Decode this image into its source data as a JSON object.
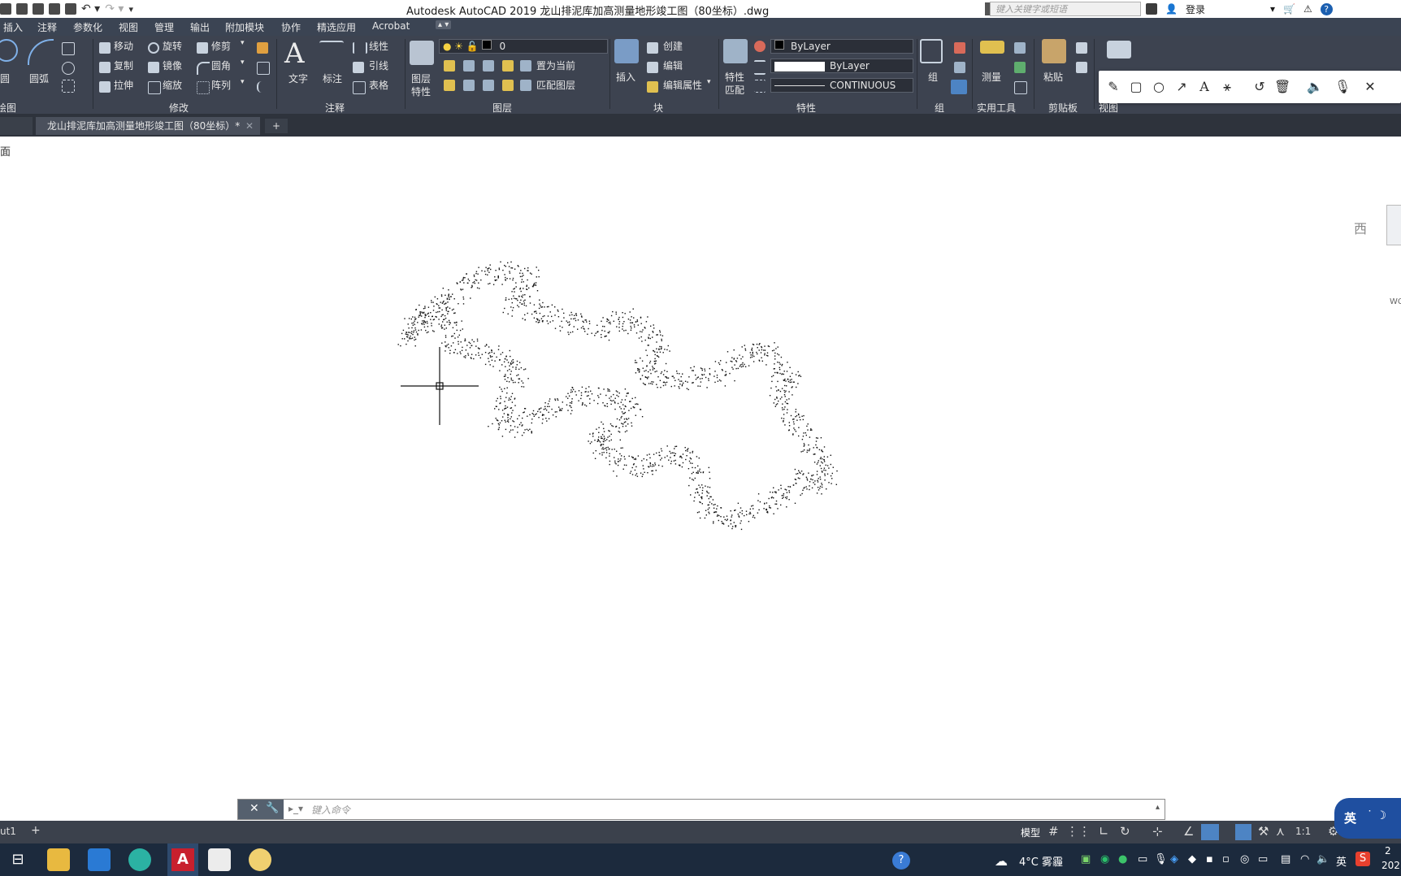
{
  "app": {
    "window_title": "Autodesk AutoCAD 2019    龙山排泥库加高测量地形竣工图（80坐标）.dwg",
    "search_placeholder": "键入关键字或短语",
    "login": "登录"
  },
  "menu_tabs": [
    "插入",
    "注释",
    "参数化",
    "视图",
    "管理",
    "输出",
    "附加模块",
    "协作",
    "精选应用",
    "Acrobat"
  ],
  "ribbon": {
    "draw": {
      "circle": "圆",
      "arc": "圆弧",
      "panel_title": "绘图"
    },
    "modify": {
      "move": "移动",
      "rotate": "旋转",
      "trim": "修剪",
      "copy": "复制",
      "mirror": "镜像",
      "fillet": "圆角",
      "stretch": "拉伸",
      "scale": "缩放",
      "array": "阵列",
      "panel_title": "修改"
    },
    "annotation": {
      "text": "文字",
      "dimension": "标注",
      "linear": "线性",
      "leader": "引线",
      "table": "表格",
      "panel_title": "注释"
    },
    "layers": {
      "layer_props_1": "图层",
      "layer_props_2": "特性",
      "current_layer": "0",
      "set_current": "置为当前",
      "match_layer": "匹配图层",
      "panel_title": "图层"
    },
    "block": {
      "insert": "插入",
      "create": "创建",
      "edit": "编辑",
      "edit_attr": "编辑属性",
      "panel_title": "块"
    },
    "properties": {
      "match_1": "特性",
      "match_2": "匹配",
      "color": "ByLayer",
      "lineweight": "ByLayer",
      "linetype": "CONTINUOUS",
      "panel_title": "特性"
    },
    "groups": {
      "group": "组",
      "panel_title": "组"
    },
    "utilities": {
      "measure": "测量",
      "panel_title": "实用工具"
    },
    "clipboard": {
      "paste": "粘贴",
      "panel_title": "剪贴板"
    },
    "view": {
      "panel_title": "视图"
    }
  },
  "doc_tab": {
    "label": "龙山排泥库加高测量地形竣工图（80坐标）*"
  },
  "canvas": {
    "corner_label": "面",
    "viewcube_label": "西",
    "viewcube_wcs": "WC"
  },
  "command": {
    "placeholder": "键入命令"
  },
  "status": {
    "layout_tab": "ut1",
    "model": "模型",
    "scale": "1:1"
  },
  "taskbar": {
    "weather": "4°C 雾霾",
    "ime_lang": "英",
    "year_fragment": "202",
    "clock_fragment": "2"
  },
  "ime": {
    "label": "英"
  },
  "colors": {
    "ribbon_bg": "#3d4350",
    "menubar_bg": "#3b4453",
    "taskbar_bg": "#1c2a3d"
  }
}
